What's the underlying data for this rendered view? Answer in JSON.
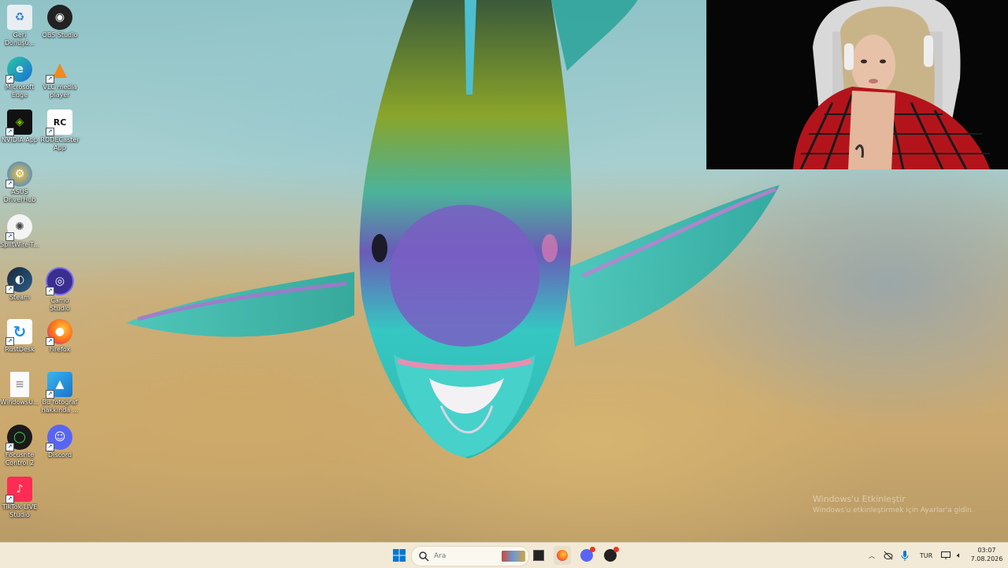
{
  "desktop_icons": [
    {
      "label": "Geri Dönüşü...",
      "icon": "recycle-bin-icon"
    },
    {
      "label": "OBS Studio",
      "icon": "obs-studio-icon"
    },
    {
      "label": "Microsoft Edge",
      "icon": "edge-icon"
    },
    {
      "label": "VLC media player",
      "icon": "vlc-icon"
    },
    {
      "label": "NVIDIA App",
      "icon": "nvidia-icon"
    },
    {
      "label": "RODECaster App",
      "icon": "rodecaster-icon"
    },
    {
      "label": "ASUS DriverHub",
      "icon": "asus-driverhub-icon"
    },
    {
      "label": "SplitWire-T...",
      "icon": "splitwire-icon"
    },
    {
      "label": "Steam",
      "icon": "steam-icon"
    },
    {
      "label": "Camo Studio",
      "icon": "camo-studio-icon"
    },
    {
      "label": "RustDesk",
      "icon": "rustdesk-icon"
    },
    {
      "label": "Firefox",
      "icon": "firefox-icon"
    },
    {
      "label": "WindowsU...",
      "icon": "document-icon"
    },
    {
      "label": "Bu fotoğraf hakkında ...",
      "icon": "photo-info-icon"
    },
    {
      "label": "Focusrite Control 2",
      "icon": "focusrite-icon"
    },
    {
      "label": "Discord",
      "icon": "discord-icon"
    },
    {
      "label": "TikTok LIVE Studio",
      "icon": "tiktok-live-icon"
    }
  ],
  "watermark": {
    "title": "Windows'u Etkinleştir",
    "subtitle": "Windows'u etkinleştirmek için Ayarlar'a gidin."
  },
  "taskbar": {
    "search_placeholder": "Ara",
    "language": "TUR",
    "time": "03:07",
    "date": "7.08.2026",
    "pinned": [
      "widgets-icon",
      "file-explorer-icon",
      "firefox-icon",
      "discord-icon",
      "obs-studio-icon"
    ]
  },
  "colors": {
    "taskbar_bg": "#f2ead6",
    "windows_blue": "#0078d4"
  }
}
